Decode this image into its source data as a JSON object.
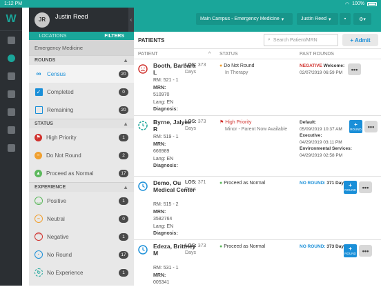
{
  "statusbar": {
    "time": "1:12 PM",
    "battery": "100%"
  },
  "side": {
    "user_initials": "JR",
    "user_name": "Justin Reed",
    "tab_locations": "LOCATIONS",
    "tab_filters": "FILTERS",
    "department": "Emergency Medicine",
    "rounds_header": "ROUNDS",
    "rounds": [
      {
        "label": "Census",
        "count": "20"
      },
      {
        "label": "Completed",
        "count": "0"
      },
      {
        "label": "Remaining",
        "count": "20"
      }
    ],
    "status_header": "STATUS",
    "status": [
      {
        "label": "High Priority",
        "count": "1"
      },
      {
        "label": "Do Not Round",
        "count": "2"
      },
      {
        "label": "Proceed as Normal",
        "count": "17"
      }
    ],
    "experience_header": "EXPERIENCE",
    "experience": [
      {
        "label": "Positive",
        "count": "1"
      },
      {
        "label": "Neutral",
        "count": "0"
      },
      {
        "label": "Negative",
        "count": "1"
      },
      {
        "label": "No Round",
        "count": "17"
      },
      {
        "label": "No Experience",
        "count": "1"
      }
    ]
  },
  "topbar": {
    "location": "Main Campus - Emergency Medicine",
    "user": "Justin Reed"
  },
  "main": {
    "title": "PATIENTS",
    "search_placeholder": "Search Patient/MRN",
    "add_label": "+ Admit",
    "col_patient": "PATIENT",
    "col_status": "STATUS",
    "col_past": "PAST ROUNDS",
    "round_btn": "ROUND",
    "more": "•••",
    "patients": [
      {
        "name": "Booth, Barbara L",
        "rm": "RM: 521 - 1",
        "mrn_label": "MRN:",
        "mrn": "510970",
        "lang": "Lang: EN",
        "diag": "Diagnosis:",
        "los_label": "LOS:",
        "los": "373 Days",
        "status": "Do Not Round",
        "status_sub": "In Therapy",
        "past_kind": "NEGATIVE",
        "past_text": "Welcome:",
        "past_date": "02/07/2019 06:59 PM"
      },
      {
        "name": "Byrne, Jalyce R",
        "rm": "RM: 519 - 1",
        "mrn_label": "MRN:",
        "mrn": "666989",
        "lang": "Lang: EN",
        "diag": "Diagnosis:",
        "los_label": "LOS:",
        "los": "373 Days",
        "status": "High Priority",
        "status_sub": "Minor - Parent Now Available",
        "past_default": "Default:",
        "past_default_date": "05/09/2019 10:37 AM",
        "past_exec": "Executive:",
        "past_exec_date": "04/29/2019 03:11 PM",
        "past_env": "Environmental Services:",
        "past_env_date": "04/29/2019 02:58 PM"
      },
      {
        "name": "Demo, Ou Medical Center",
        "rm": "RM: 515 - 2",
        "mrn_label": "MRN:",
        "mrn": "3582764",
        "lang": "Lang: EN",
        "diag": "Diagnosis:",
        "los_label": "LOS:",
        "los": "371 Days",
        "status": "Proceed as Normal",
        "past_kind": "NO ROUND:",
        "past_text": "371 Days"
      },
      {
        "name": "Edeza, Brittney M",
        "rm": "RM: 531 - 1",
        "mrn_label": "MRN:",
        "mrn": "005341",
        "los_label": "LOS:",
        "los": "373 Days",
        "status": "Proceed as Normal",
        "past_kind": "NO ROUND:",
        "past_text": "373 Days"
      }
    ]
  },
  "colors": {
    "teal": "#1aa69a",
    "blue": "#1a8fd8",
    "red": "#d0312d",
    "orange": "#f0a030",
    "green": "#5cb85c"
  }
}
